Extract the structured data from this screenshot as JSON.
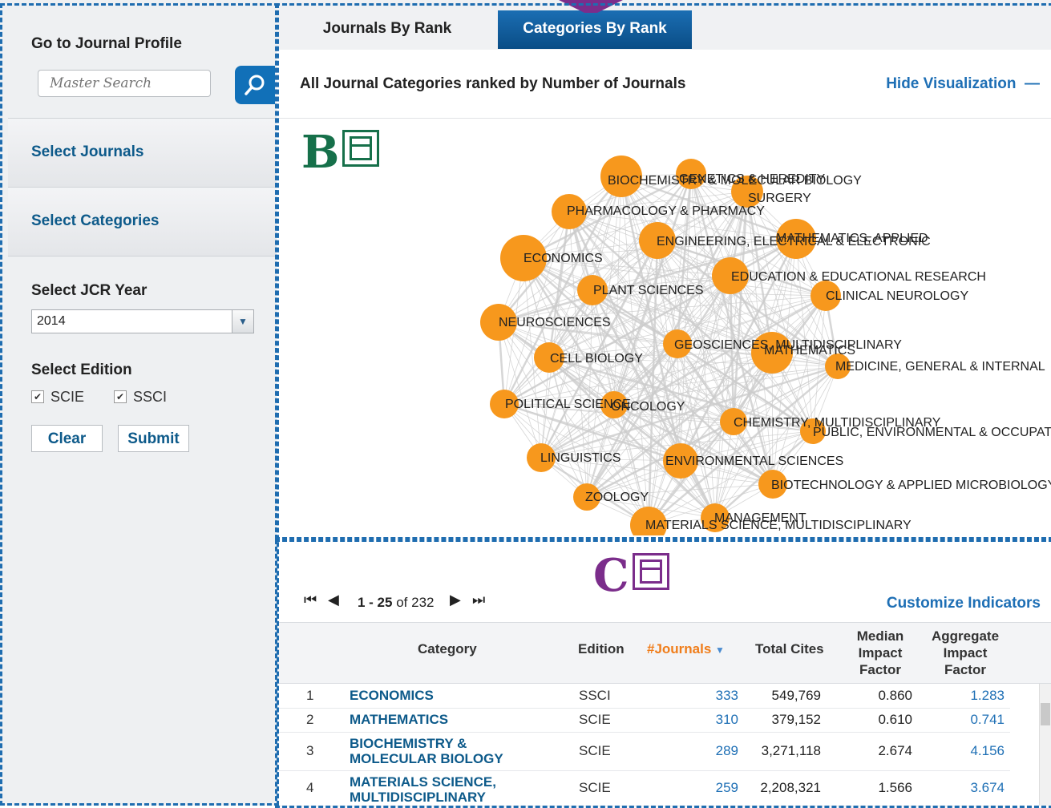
{
  "sidebar": {
    "profile_heading": "Go to Journal Profile",
    "search_placeholder": "Master Search",
    "select_journals": "Select Journals",
    "select_categories": "Select Categories",
    "jcr_year_label": "Select JCR Year",
    "jcr_year_value": "2014",
    "edition_label": "Select Edition",
    "editions": [
      "SCIE",
      "SSCI"
    ],
    "clear_label": "Clear",
    "submit_label": "Submit"
  },
  "tabs": [
    "Journals By Rank",
    "Categories By Rank"
  ],
  "visualization": {
    "title": "All Journal Categories ranked by Number of Journals",
    "hide_label": "Hide Visualization",
    "badge_label": "B",
    "node_color": "#f7981d",
    "edge_color": "#cccccc",
    "nodes": [
      "BIOCHEMISTRY & MOLECULAR BIOLOGY",
      "GENETICS & HEREDITY",
      "SURGERY",
      "PHARMACOLOGY & PHARMACY",
      "ENGINEERING, ELECTRICAL & ELECTRONIC",
      "MATHEMATICS, APPLIED",
      "ECONOMICS",
      "EDUCATION & EDUCATIONAL RESEARCH",
      "PLANT SCIENCES",
      "CLINICAL NEUROLOGY",
      "NEUROSCIENCES",
      "GEOSCIENCES, MULTIDISCIPLINARY",
      "MATHEMATICS",
      "CELL BIOLOGY",
      "MEDICINE, GENERAL & INTERNAL",
      "POLITICAL SCIENCE",
      "ONCOLOGY",
      "CHEMISTRY, MULTIDISCIPLINARY",
      "PUBLIC, ENVIRONMENTAL & OCCUPATIONAL HEALTH",
      "LINGUISTICS",
      "ENVIRONMENTAL SCIENCES",
      "BIOTECHNOLOGY & APPLIED MICROBIOLOGY",
      "ZOOLOGY",
      "MANAGEMENT",
      "MATERIALS SCIENCE, MULTIDISCIPLINARY"
    ]
  },
  "table": {
    "badge_label": "C",
    "pager_start": "1 - 25",
    "pager_total": "of 232",
    "customize_label": "Customize Indicators",
    "headers": {
      "category": "Category",
      "edition": "Edition",
      "journals": "#Journals",
      "total_cites": "Total Cites",
      "median_if": "Median Impact Factor",
      "aggregate_if": "Aggregate Impact Factor"
    },
    "rows": [
      {
        "rank": "1",
        "category": "ECONOMICS",
        "edition": "SSCI",
        "journals": "333",
        "total_cites": "549,769",
        "median_if": "0.860",
        "aggregate_if": "1.283"
      },
      {
        "rank": "2",
        "category": "MATHEMATICS",
        "edition": "SCIE",
        "journals": "310",
        "total_cites": "379,152",
        "median_if": "0.610",
        "aggregate_if": "0.741"
      },
      {
        "rank": "3",
        "category": "BIOCHEMISTRY & MOLECULAR BIOLOGY",
        "edition": "SCIE",
        "journals": "289",
        "total_cites": "3,271,118",
        "median_if": "2.674",
        "aggregate_if": "4.156"
      },
      {
        "rank": "4",
        "category": "MATERIALS SCIENCE, MULTIDISCIPLINARY",
        "edition": "SCIE",
        "journals": "259",
        "total_cites": "2,208,321",
        "median_if": "1.566",
        "aggregate_if": "3.674"
      }
    ]
  },
  "colors": {
    "accent_blue": "#1e6fb5",
    "link_dark": "#0d5a8a",
    "sort_orange": "#f07d1a",
    "badge_green": "#16704a",
    "badge_purple": "#7b2d8b",
    "frame_dash": "#1f6db0"
  }
}
